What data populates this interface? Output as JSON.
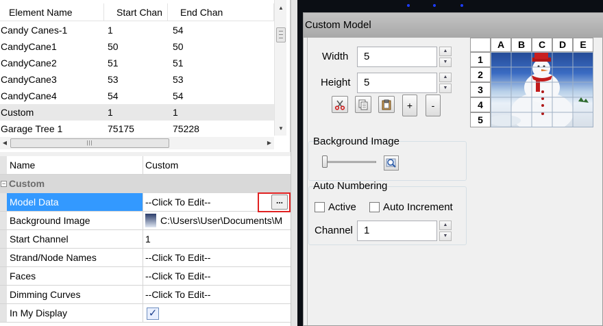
{
  "element_list": {
    "headers": [
      "Element Name",
      "Start Chan",
      "End Chan"
    ],
    "rows": [
      {
        "name": "Candy Canes-1",
        "start": "1",
        "end": "54"
      },
      {
        "name": "CandyCane1",
        "start": "50",
        "end": "50"
      },
      {
        "name": "CandyCane2",
        "start": "51",
        "end": "51"
      },
      {
        "name": "CandyCane3",
        "start": "53",
        "end": "53"
      },
      {
        "name": "CandyCane4",
        "start": "54",
        "end": "54"
      },
      {
        "name": "Custom",
        "start": "1",
        "end": "1"
      },
      {
        "name": "Garage Tree 1",
        "start": "75175",
        "end": "75228"
      }
    ],
    "selected_row": "Custom"
  },
  "property_grid": {
    "name_row": {
      "label": "Name",
      "value": "Custom"
    },
    "category": "Custom",
    "properties": [
      {
        "label": "Model Data",
        "value": "--Click To Edit--"
      },
      {
        "label": "Background Image",
        "value": "C:\\Users\\User\\Documents\\M"
      },
      {
        "label": "Start Channel",
        "value": "1"
      },
      {
        "label": "Strand/Node Names",
        "value": "--Click To Edit--"
      },
      {
        "label": "Faces",
        "value": "--Click To Edit--"
      },
      {
        "label": "Dimming Curves",
        "value": "--Click To Edit--"
      },
      {
        "label": "In My Display",
        "value": "checked"
      }
    ],
    "ellipsis_label": "...",
    "checkbox_mark": "✓"
  },
  "dialog": {
    "title": "Custom Model",
    "width_label": "Width",
    "width_value": "5",
    "height_label": "Height",
    "height_value": "5",
    "toolbar": {
      "cut_icon": "scissors-icon",
      "copy_icon": "copy-icon",
      "paste_icon": "paste-icon",
      "plus_label": "+",
      "minus_label": "-"
    },
    "background_image": {
      "title": "Background Image",
      "brightness_slider_value": 0,
      "zoom_icon": "magnifier-icon"
    },
    "auto_numbering": {
      "title": "Auto Numbering",
      "active_label": "Active",
      "active_checked": false,
      "auto_increment_label": "Auto Increment",
      "auto_increment_checked": false,
      "channel_label": "Channel",
      "channel_value": "1"
    },
    "grid": {
      "columns": [
        "A",
        "B",
        "C",
        "D",
        "E"
      ],
      "rows": [
        "1",
        "2",
        "3",
        "4",
        "5"
      ]
    }
  },
  "colors": {
    "selection_blue": "#3399ff",
    "highlight_red": "#e02020",
    "category_gray": "#d9d9d9"
  }
}
